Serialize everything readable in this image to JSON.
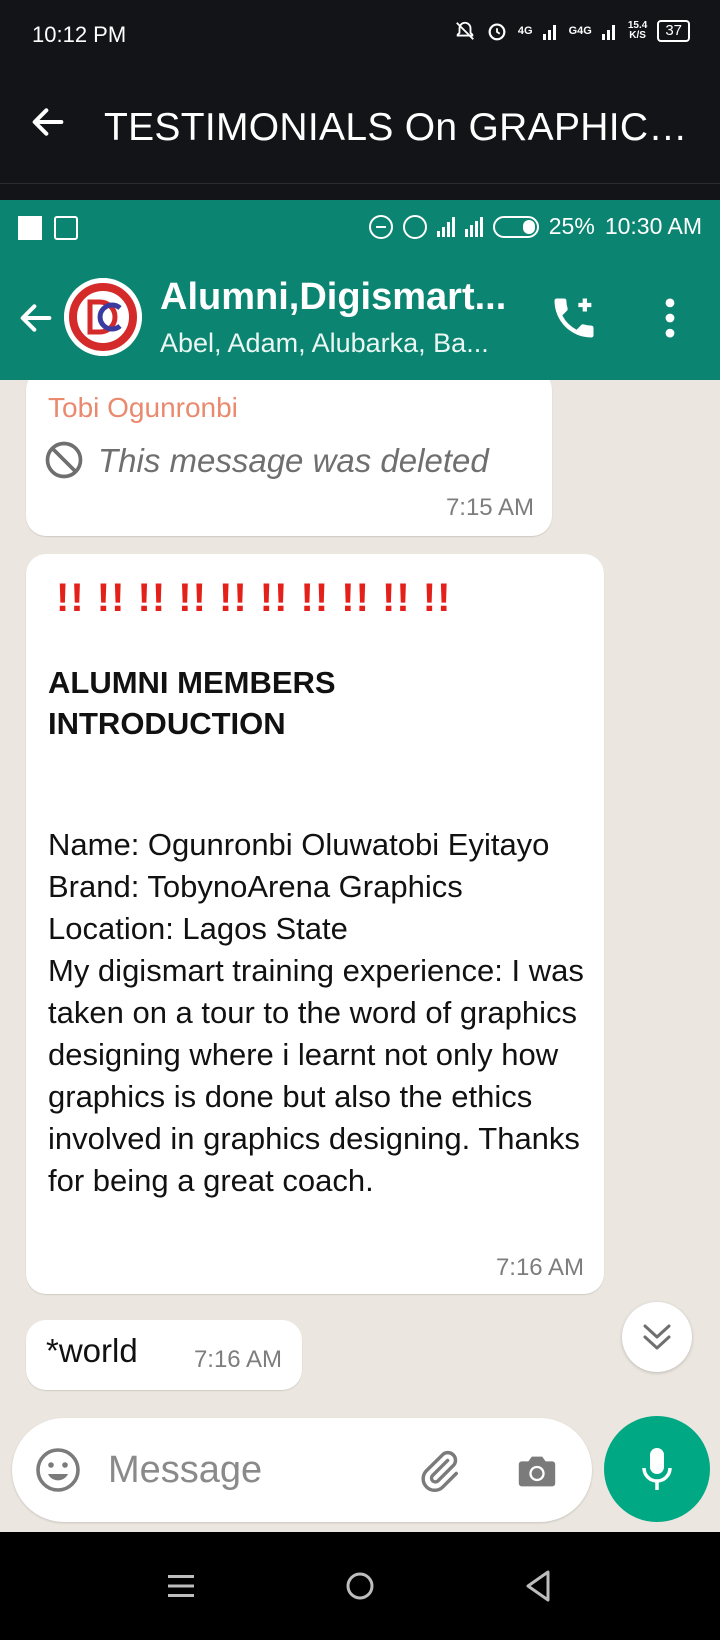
{
  "outer_status": {
    "time": "10:12 PM",
    "net1": "4G",
    "net2": "G4G",
    "speed_value": "15.4",
    "speed_unit": "K/S",
    "battery": "37"
  },
  "outer_appbar": {
    "title": "TESTIMONIALS On GRAPHICS DESIGN"
  },
  "inner_status": {
    "battery_percent": "25%",
    "time": "10:30 AM"
  },
  "chat_header": {
    "group_name": "Alumni,Digismart...",
    "members": "Abel, Adam, Alubarka, Ba..."
  },
  "messages": [
    {
      "sender": "Tobi Ogunronbi",
      "text": "This message was deleted",
      "time": "7:15 AM"
    },
    {
      "marks": "!! !! !! !! !! !! !! !! !! !!",
      "heading": "ALUMNI MEMBERS INTRODUCTION",
      "lines": [
        "Name: Ogunronbi Oluwatobi Eyitayo",
        "Brand: TobynoArena Graphics",
        "Location: Lagos State",
        "My digismart training experience: I was taken on a tour to the word of graphics designing where i learnt not only how graphics is done but also the ethics involved in graphics designing. Thanks for being a great coach."
      ],
      "time": "7:16 AM"
    },
    {
      "text": "*world",
      "time": "7:16 AM"
    }
  ],
  "composer": {
    "placeholder": "Message"
  },
  "icons": {
    "back": "arrow-left-icon",
    "call": "add-call-icon",
    "more": "more-vert-icon",
    "deleted": "block-icon",
    "emoji": "emoji-icon",
    "attach": "paperclip-icon",
    "camera": "camera-icon",
    "mic": "mic-icon",
    "scroll": "double-chevron-down-icon"
  },
  "colors": {
    "header": "#0b8571",
    "chat_bg": "#ebe6df",
    "sender": "#e98a6e",
    "marks": "#e4201a",
    "mic": "#00a884"
  }
}
